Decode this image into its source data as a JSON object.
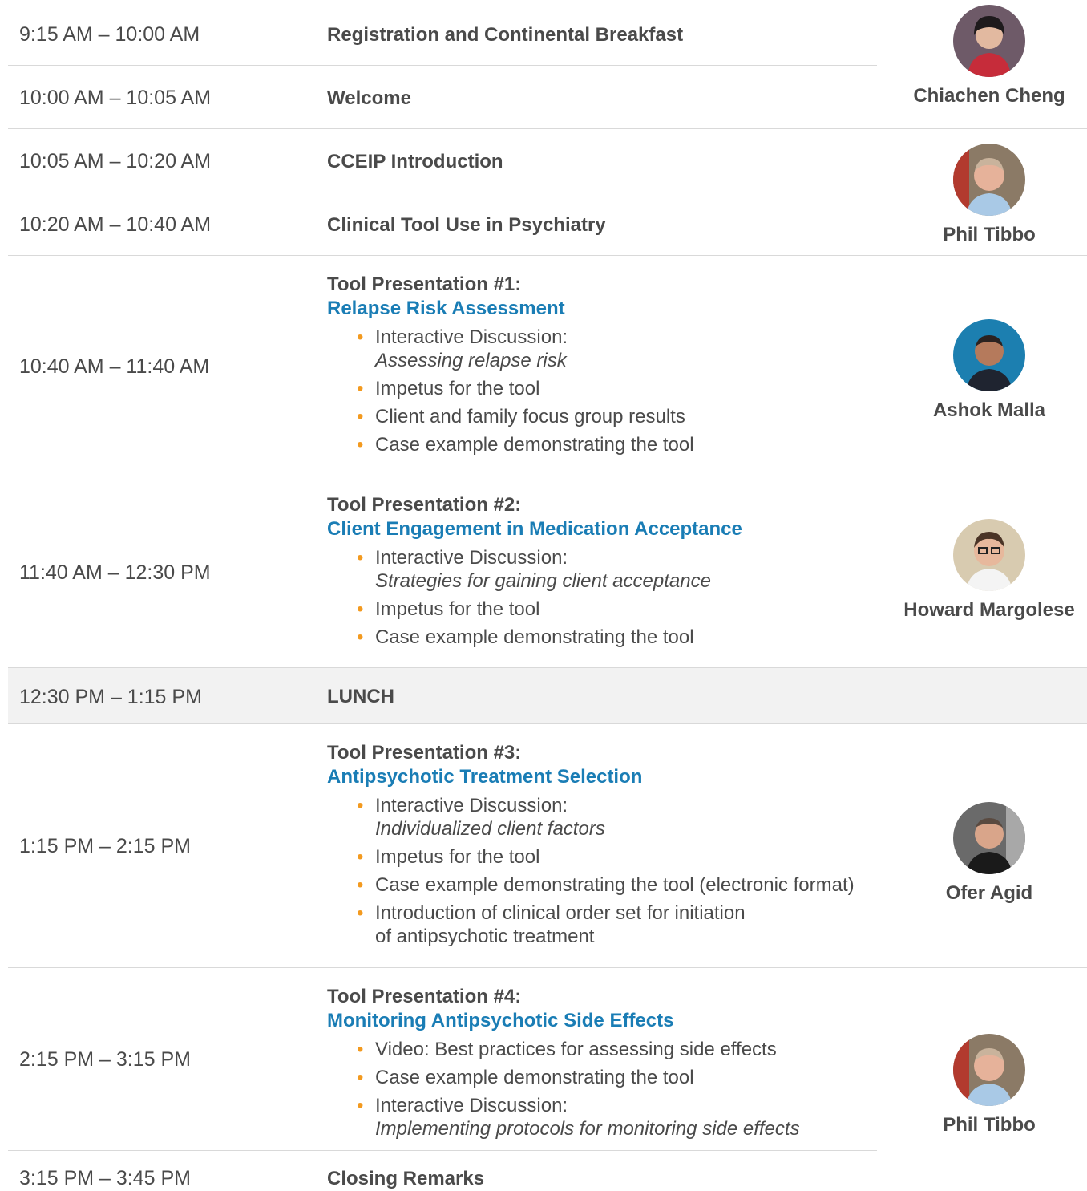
{
  "rows": [
    {
      "time": "9:15 AM – 10:00 AM",
      "title": "Registration and Continental Breakfast"
    },
    {
      "time": "10:00 AM – 10:05 AM",
      "title": "Welcome"
    },
    {
      "time": "10:05 AM – 10:20 AM",
      "title": "CCEIP Introduction"
    },
    {
      "time": "10:20 AM – 10:40 AM",
      "title": "Clinical Tool Use in Psychiatry"
    },
    {
      "time": "10:40 AM – 11:40 AM",
      "head": "Tool Presentation #1:",
      "sub": "Relapse Risk Assessment",
      "bullets": [
        {
          "text": "Interactive Discussion:",
          "em": "Assessing relapse risk"
        },
        {
          "text": "Impetus for the tool"
        },
        {
          "text": "Client and family focus group results"
        },
        {
          "text": "Case example demonstrating the tool"
        }
      ]
    },
    {
      "time": "11:40 AM – 12:30 PM",
      "head": "Tool Presentation #2:",
      "sub": "Client Engagement in Medication Acceptance",
      "bullets": [
        {
          "text": "Interactive Discussion:",
          "em": "Strategies for gaining client acceptance"
        },
        {
          "text": "Impetus for the tool"
        },
        {
          "text": "Case example demonstrating the tool"
        }
      ]
    },
    {
      "time": "12:30 PM – 1:15 PM",
      "title": "LUNCH"
    },
    {
      "time": "1:15 PM – 2:15 PM",
      "head": "Tool Presentation #3:",
      "sub": "Antipsychotic Treatment Selection",
      "bullets": [
        {
          "text": "Interactive Discussion:",
          "em": "Individualized client factors"
        },
        {
          "text": "Impetus for the tool"
        },
        {
          "text": "Case example demonstrating the tool (electronic format)"
        },
        {
          "text": "Introduction of clinical order set for initiation",
          "em2": "of antipsychotic treatment"
        }
      ]
    },
    {
      "time": "2:15 PM – 3:15 PM",
      "head": "Tool Presentation #4:",
      "sub": "Monitoring Antipsychotic Side Effects",
      "bullets": [
        {
          "text": "Video: Best practices for assessing side effects"
        },
        {
          "text": "Case example demonstrating the tool"
        },
        {
          "text": "Interactive Discussion:",
          "em": "Implementing protocols for monitoring side effects"
        }
      ]
    },
    {
      "time": "3:15 PM – 3:45 PM",
      "title": "Closing Remarks"
    }
  ],
  "speakers": [
    {
      "name": "Chiachen Cheng",
      "icon": "speaker-photo"
    },
    {
      "name": "Phil Tibbo",
      "icon": "speaker-photo"
    },
    {
      "name": "Ashok Malla",
      "icon": "speaker-photo"
    },
    {
      "name": "Howard Margolese",
      "icon": "speaker-photo"
    },
    {
      "name": "Ofer Agid",
      "icon": "speaker-photo"
    },
    {
      "name": "Phil Tibbo",
      "icon": "speaker-photo"
    }
  ],
  "colors": {
    "accent": "#1a7db5",
    "bullet": "#f39a1f",
    "text": "#4a4a4a",
    "lunch": "#f2f2f2"
  }
}
